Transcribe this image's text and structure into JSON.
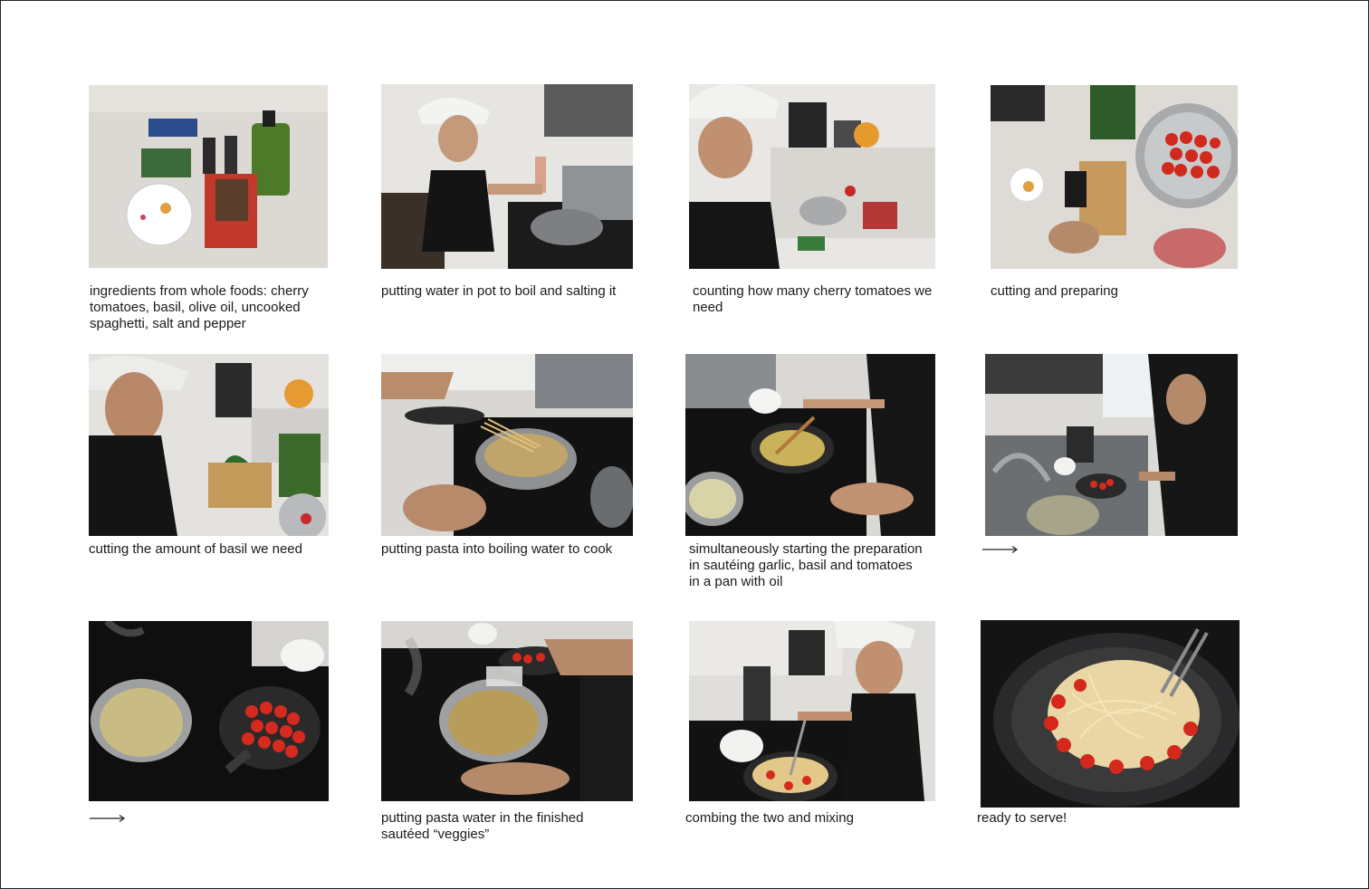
{
  "steps": [
    {
      "caption": "ingredients from whole foods: cherry tomatoes, basil, olive oil, uncooked spaghetti, salt and pepper"
    },
    {
      "caption": "putting water in pot to boil and salting it"
    },
    {
      "caption": "counting how many cherry tomatoes we need"
    },
    {
      "caption": "cutting and preparing"
    },
    {
      "caption": "cutting the amount of basil we need"
    },
    {
      "caption": "putting pasta into boiling water to cook"
    },
    {
      "caption": "simultaneously starting the preparation in sautéing garlic, basil and tomatoes in a pan with oil"
    },
    {
      "caption": ""
    },
    {
      "caption": ""
    },
    {
      "caption": "putting pasta water in the finished sautéed “veggies”"
    },
    {
      "caption": "combing the two and mixing"
    },
    {
      "caption": "ready to serve!"
    }
  ],
  "icons": {
    "continuation": "arrow-right-icon"
  }
}
